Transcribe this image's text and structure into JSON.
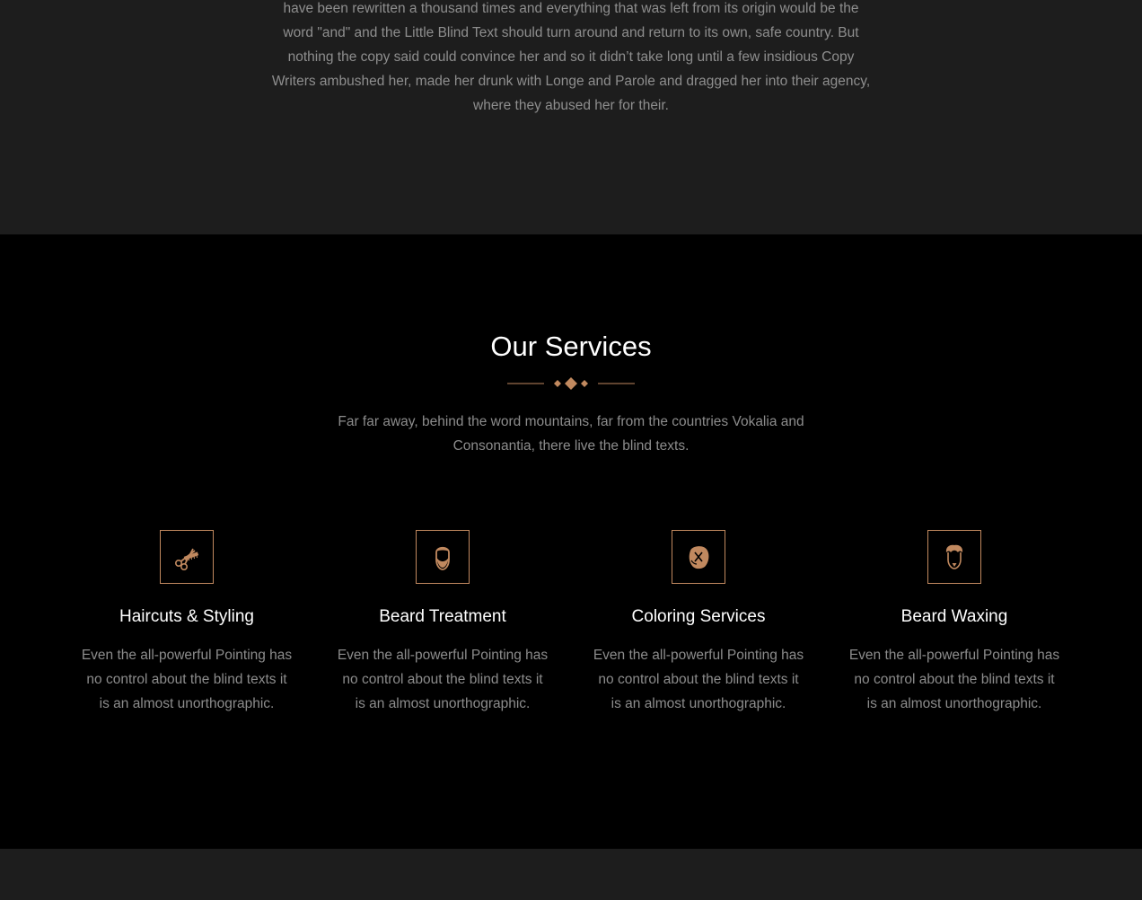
{
  "about": {
    "lines": [
      "have been rewritten a thousand times and everything that was left from its origin would be the",
      "word \"and\" and the Little Blind Text should turn around and return to its own, safe country. But",
      "nothing the copy said could convince her and so it didn’t take long until a few insidious Copy",
      "Writers ambushed her, made her drunk with Longe and Parole and dragged her into their agency,",
      "where they abused her for their."
    ]
  },
  "services": {
    "title": "Our Services",
    "intro_lines": [
      "Far far away, behind the word mountains, far from the countries Vokalia and",
      "Consonantia, there live the blind texts."
    ],
    "items": [
      {
        "icon": "scissors-comb-icon",
        "name": "Haircuts & Styling",
        "desc_lines": [
          "Even the all-powerful Pointing has",
          "no control about the blind texts it",
          "is an almost unorthographic."
        ]
      },
      {
        "icon": "beard-face-icon",
        "name": "Beard Treatment",
        "desc_lines": [
          "Even the all-powerful Pointing has",
          "no control about the blind texts it",
          "is an almost unorthographic."
        ]
      },
      {
        "icon": "hair-coloring-icon",
        "name": "Coloring Services",
        "desc_lines": [
          "Even the all-powerful Pointing has",
          "no control about the blind texts it",
          "is an almost unorthographic."
        ]
      },
      {
        "icon": "beard-waxing-icon",
        "name": "Beard Waxing",
        "desc_lines": [
          "Even the all-powerful Pointing has",
          "no control about the blind texts it",
          "is an almost unorthographic."
        ]
      }
    ]
  },
  "colors": {
    "accent": "#c1895f",
    "dark_bg": "#1d1d1d",
    "black_bg": "#000000",
    "muted_text": "#8c8c8c",
    "heading_text": "#ffffff"
  }
}
